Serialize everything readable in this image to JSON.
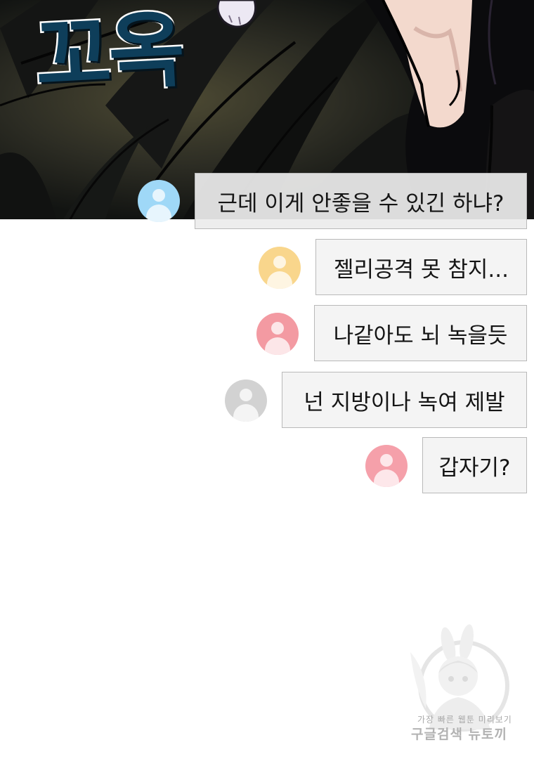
{
  "panel": {
    "sound_effect": "꼬옥"
  },
  "messages": [
    {
      "text": "근데 이게 안좋을 수 있긴 하냐?",
      "avatar_color": "#9fd8f7"
    },
    {
      "text": "젤리공격 못 참지...",
      "avatar_color": "#f9d68c"
    },
    {
      "text": "나같아도 뇌 녹을듯",
      "avatar_color": "#f39aa2"
    },
    {
      "text": "넌 지방이나 녹여 제발",
      "avatar_color": "#d2d2d2"
    },
    {
      "text": "갑자기?",
      "avatar_color": "#f5a0aa"
    }
  ],
  "watermark": {
    "line1": "가장 빠른 웹툰 미리보기",
    "line2": "구글검색 뉴토끼"
  }
}
